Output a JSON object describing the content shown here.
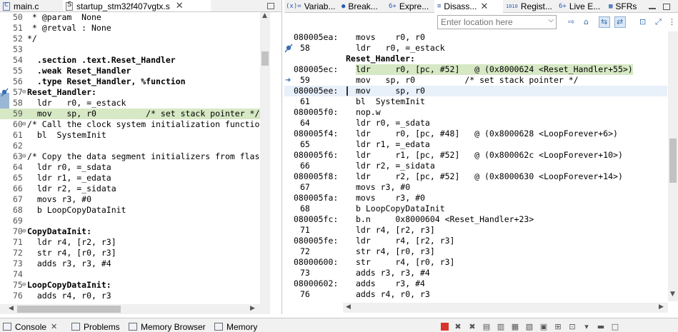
{
  "editor_tabs": [
    {
      "label": "main.c",
      "icon": "c-file-icon"
    },
    {
      "label": "startup_stm32f407vgtx.s",
      "icon": "asm-file-icon",
      "close": "✕"
    }
  ],
  "source_lines": [
    {
      "n": "50",
      "code": " * @param  None",
      "style": "cm"
    },
    {
      "n": "51",
      "code": " * @retval : None",
      "style": "cm"
    },
    {
      "n": "52",
      "code": "*/",
      "style": "cm"
    },
    {
      "n": "53",
      "code": "",
      "style": ""
    },
    {
      "n": "54",
      "code": "  .section .text.Reset_Handler",
      "style": "kw"
    },
    {
      "n": "55",
      "code": "  .weak Reset_Handler",
      "style": "kw"
    },
    {
      "n": "56",
      "code": "  .type Reset_Handler, %function",
      "style": "kw"
    },
    {
      "n": "57",
      "code": "Reset_Handler:",
      "style": "lbl"
    },
    {
      "n": "58",
      "code": "  ldr   r0, =_estack",
      "style": ""
    },
    {
      "n": "59",
      "code": "  mov   sp, r0          /* set stack pointer */",
      "style": "hl"
    },
    {
      "n": "60",
      "code": "/* Call the clock system initialization function.*/",
      "style": "cm"
    },
    {
      "n": "61",
      "code": "  bl  SystemInit",
      "style": ""
    },
    {
      "n": "62",
      "code": "",
      "style": ""
    },
    {
      "n": "63",
      "code": "/* Copy the data segment initializers from flash to SRAM */",
      "style": "cm"
    },
    {
      "n": "64",
      "code": "  ldr r0, =_sdata",
      "style": ""
    },
    {
      "n": "65",
      "code": "  ldr r1, =_edata",
      "style": ""
    },
    {
      "n": "66",
      "code": "  ldr r2, =_sidata",
      "style": ""
    },
    {
      "n": "67",
      "code": "  movs r3, #0",
      "style": ""
    },
    {
      "n": "68",
      "code": "  b LoopCopyDataInit",
      "style": ""
    },
    {
      "n": "69",
      "code": "",
      "style": ""
    },
    {
      "n": "70",
      "code": "CopyDataInit:",
      "style": "lbl"
    },
    {
      "n": "71",
      "code": "  ldr r4, [r2, r3]",
      "style": ""
    },
    {
      "n": "72",
      "code": "  str r4, [r0, r3]",
      "style": ""
    },
    {
      "n": "73",
      "code": "  adds r3, r3, #4",
      "style": ""
    },
    {
      "n": "74",
      "code": "",
      "style": ""
    },
    {
      "n": "75",
      "code": "LoopCopyDataInit:",
      "style": "lbl"
    },
    {
      "n": "76",
      "code": "  adds r4, r0, r3",
      "style": ""
    }
  ],
  "view_tabs": [
    {
      "label": "Variab...",
      "icon": "(x)="
    },
    {
      "label": "Break...",
      "icon": "●"
    },
    {
      "label": "Expre...",
      "icon": "6+"
    },
    {
      "label": "Disass...",
      "icon": "≡",
      "active": true,
      "close": "✕"
    },
    {
      "label": "Regist...",
      "icon": "1010"
    },
    {
      "label": "Live E...",
      "icon": "6+"
    },
    {
      "label": "SFRs",
      "icon": "▦"
    }
  ],
  "location": {
    "placeholder": "Enter location here",
    "value": "Enter location here"
  },
  "disasm": [
    {
      "t": "ins",
      "addr": "080005ea:",
      "ins": "movs    r0, r0"
    },
    {
      "t": "src",
      "num": "58",
      "ins": "ldr   r0, =_estack"
    },
    {
      "t": "label",
      "ins": "Reset_Handler:"
    },
    {
      "t": "ins",
      "addr": "080005ec:",
      "ins": "ldr     r0, [pc, #52]   @ (0x8000624 <Reset_Handler+55>)",
      "hl": "hl1"
    },
    {
      "t": "src",
      "num": "59",
      "ins": "mov   sp, r0          /* set stack pointer */"
    },
    {
      "t": "ins",
      "addr": "080005ee:",
      "ins": "mov     sp, r0",
      "hl": "hl2"
    },
    {
      "t": "src",
      "num": "61",
      "ins": "bl  SystemInit"
    },
    {
      "t": "ins",
      "addr": "080005f0:",
      "ins": "nop.w"
    },
    {
      "t": "src",
      "num": "64",
      "ins": "ldr r0, =_sdata"
    },
    {
      "t": "ins",
      "addr": "080005f4:",
      "ins": "ldr     r0, [pc, #48]   @ (0x8000628 <LoopForever+6>)"
    },
    {
      "t": "src",
      "num": "65",
      "ins": "ldr r1, =_edata"
    },
    {
      "t": "ins",
      "addr": "080005f6:",
      "ins": "ldr     r1, [pc, #52]   @ (0x800062c <LoopForever+10>)"
    },
    {
      "t": "src",
      "num": "66",
      "ins": "ldr r2, =_sidata"
    },
    {
      "t": "ins",
      "addr": "080005f8:",
      "ins": "ldr     r2, [pc, #52]   @ (0x8000630 <LoopForever+14>)"
    },
    {
      "t": "src",
      "num": "67",
      "ins": "movs r3, #0"
    },
    {
      "t": "ins",
      "addr": "080005fa:",
      "ins": "movs    r3, #0"
    },
    {
      "t": "src",
      "num": "68",
      "ins": "b LoopCopyDataInit"
    },
    {
      "t": "ins",
      "addr": "080005fc:",
      "ins": "b.n     0x8000604 <Reset_Handler+23>"
    },
    {
      "t": "src",
      "num": "71",
      "ins": "ldr r4, [r2, r3]"
    },
    {
      "t": "ins",
      "addr": "080005fe:",
      "ins": "ldr     r4, [r2, r3]"
    },
    {
      "t": "src",
      "num": "72",
      "ins": "str r4, [r0, r3]"
    },
    {
      "t": "ins",
      "addr": "08000600:",
      "ins": "str     r4, [r0, r3]"
    },
    {
      "t": "src",
      "num": "73",
      "ins": "adds r3, r3, #4"
    },
    {
      "t": "ins",
      "addr": "08000602:",
      "ins": "adds    r3, #4"
    },
    {
      "t": "src",
      "num": "76",
      "ins": "adds r4, r0, r3"
    }
  ],
  "bottom_tabs": [
    {
      "label": "Console"
    },
    {
      "label": "Problems"
    },
    {
      "label": "Memory Browser"
    },
    {
      "label": "Memory"
    }
  ],
  "colors": {
    "highlight": "#d6e8c4",
    "current_line": "#e8f0fa",
    "comment": "#3f7f5f",
    "keyword": "#7f0055"
  }
}
